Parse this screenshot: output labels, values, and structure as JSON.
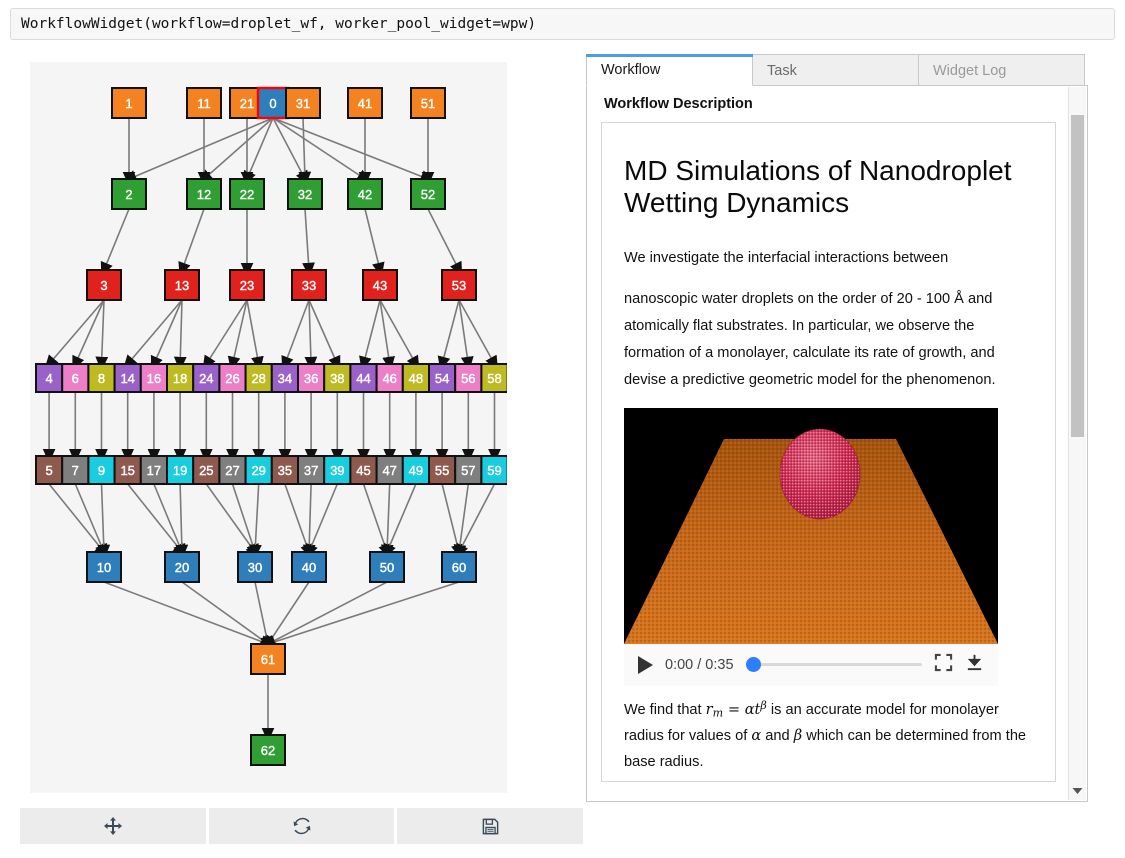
{
  "repr": {
    "text": "WorkflowWidget(workflow=droplet_wf, worker_pool_widget=wpw)"
  },
  "toolbar": {
    "buttons": [
      {
        "name": "pan-button",
        "icon": "move-arrows-icon",
        "label": ""
      },
      {
        "name": "refresh-button",
        "icon": "refresh-icon",
        "label": ""
      },
      {
        "name": "save-button",
        "icon": "floppy-disk-icon",
        "label": ""
      }
    ]
  },
  "tabs": [
    {
      "label": "Workflow",
      "active": true
    },
    {
      "label": "Task",
      "active": false
    },
    {
      "label": "Widget Log",
      "active": false
    }
  ],
  "workflow_panel": {
    "section_title": "Workflow Description",
    "heading": "MD Simulations of Nanodroplet Wetting Dynamics",
    "paragraph_1": "We investigate the interfacial interactions between",
    "paragraph_2": "nanoscopic water droplets on the order of 20 - 100 Å and atomically flat substrates. In particular, we observe the formation of a monolayer, calculate its rate of growth, and devise a predictive geometric model for the phenomenon.",
    "formula": {
      "prefix": "We find that",
      "r": "r",
      "r_sub": "m",
      "eq": "=",
      "alpha": "α",
      "t": "t",
      "t_sup": "β",
      "mid": "is an accurate model for monolayer radius for values of",
      "alpha2": "α",
      "and": "and",
      "beta2": "β",
      "suffix": "which can be determined from the base radius."
    }
  },
  "video": {
    "current_time": "0:00",
    "duration": "0:35",
    "time_label": "0:00 / 0:35",
    "progress_percent": 0,
    "play_icon": "play-icon",
    "fullscreen_icon": "fullscreen-icon",
    "download_icon": "download-icon"
  },
  "colors": {
    "orange": "#f58220",
    "green": "#2f9e33",
    "red": "#e0211c",
    "blue": "#2e7ebc",
    "purple": "#9a62c8",
    "pink": "#ec7fc8",
    "olive": "#bdba22",
    "brown": "#8f5a4e",
    "gray": "#7f7f7f",
    "cyan": "#19cde0",
    "selection": "#ff0000",
    "edge": "#7a7a7a",
    "accent": "#4a9fe0",
    "panel_bg": "#f5f5f5"
  },
  "graph": {
    "selected_node": "0",
    "rows": [
      {
        "row": 1,
        "color": "orange",
        "nodes": [
          "1",
          "11",
          "21",
          "0",
          "31",
          "41",
          "51"
        ]
      },
      {
        "row": 2,
        "color": "green",
        "nodes": [
          "2",
          "12",
          "22",
          "32",
          "42",
          "52"
        ]
      },
      {
        "row": 3,
        "color": "red",
        "nodes": [
          "3",
          "13",
          "23",
          "33",
          "43",
          "53"
        ]
      },
      {
        "row": 4,
        "color": "purple-pink-olive",
        "nodes": [
          "4",
          "6",
          "8",
          "14",
          "16",
          "18",
          "24",
          "26",
          "28",
          "34",
          "36",
          "38",
          "44",
          "46",
          "48",
          "54",
          "56",
          "58"
        ]
      },
      {
        "row": 5,
        "color": "brown-gray-cyan",
        "nodes": [
          "5",
          "7",
          "9",
          "15",
          "17",
          "19",
          "25",
          "27",
          "29",
          "35",
          "37",
          "39",
          "45",
          "47",
          "49",
          "55",
          "57",
          "59"
        ]
      },
      {
        "row": 6,
        "color": "blue",
        "nodes": [
          "10",
          "20",
          "30",
          "40",
          "50",
          "60"
        ]
      },
      {
        "row": 7,
        "color": "orange",
        "nodes": [
          "61"
        ]
      },
      {
        "row": 8,
        "color": "green",
        "nodes": [
          "62"
        ]
      }
    ]
  }
}
